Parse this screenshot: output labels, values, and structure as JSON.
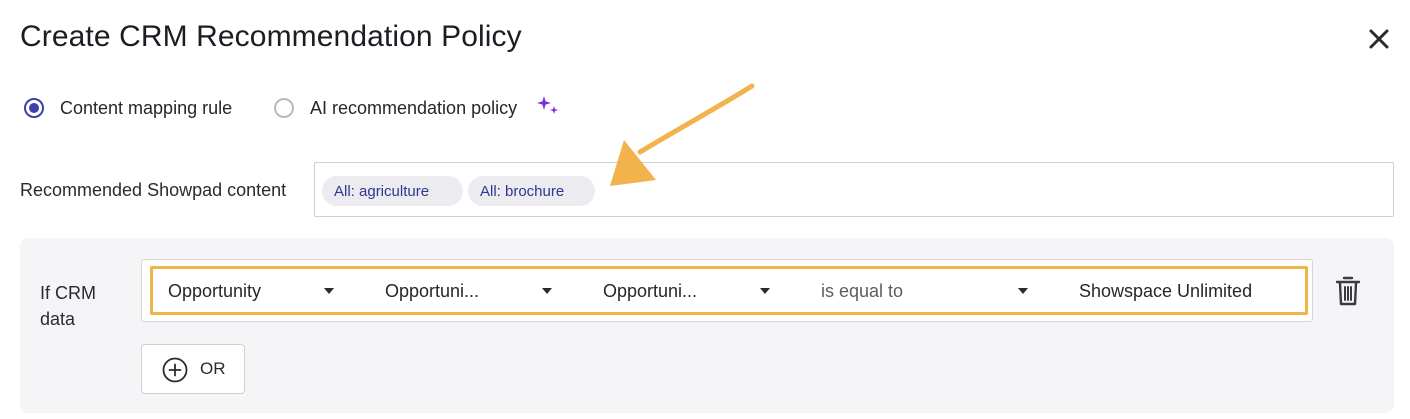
{
  "dialog": {
    "title": "Create CRM Recommendation Policy",
    "close_icon": "close-icon"
  },
  "policy_type": {
    "options": [
      {
        "label": "Content mapping rule",
        "selected": true
      },
      {
        "label": "AI recommendation policy",
        "selected": false
      }
    ],
    "ai_badge_icon": "sparkle-icon",
    "accent_color": "#3b3fb0",
    "sparkle_color": "#7b2fe0"
  },
  "recommended_content": {
    "label": "Recommended Showpad content",
    "chips": [
      "All: agriculture",
      "All: brochure"
    ]
  },
  "rule": {
    "if_label": "If CRM data",
    "selects": [
      {
        "value": "Opportunity"
      },
      {
        "value": "Opportuni..."
      },
      {
        "value": "Opportuni..."
      },
      {
        "value": "is equal to"
      }
    ],
    "value": "Showspace Unlimited",
    "delete_icon": "trash-icon",
    "highlight_color": "#f0b349"
  },
  "or_button": {
    "label": "OR",
    "icon": "plus-circle-icon"
  },
  "annotation": {
    "arrow_icon": "callout-arrow-icon",
    "color": "#f2b24c"
  }
}
